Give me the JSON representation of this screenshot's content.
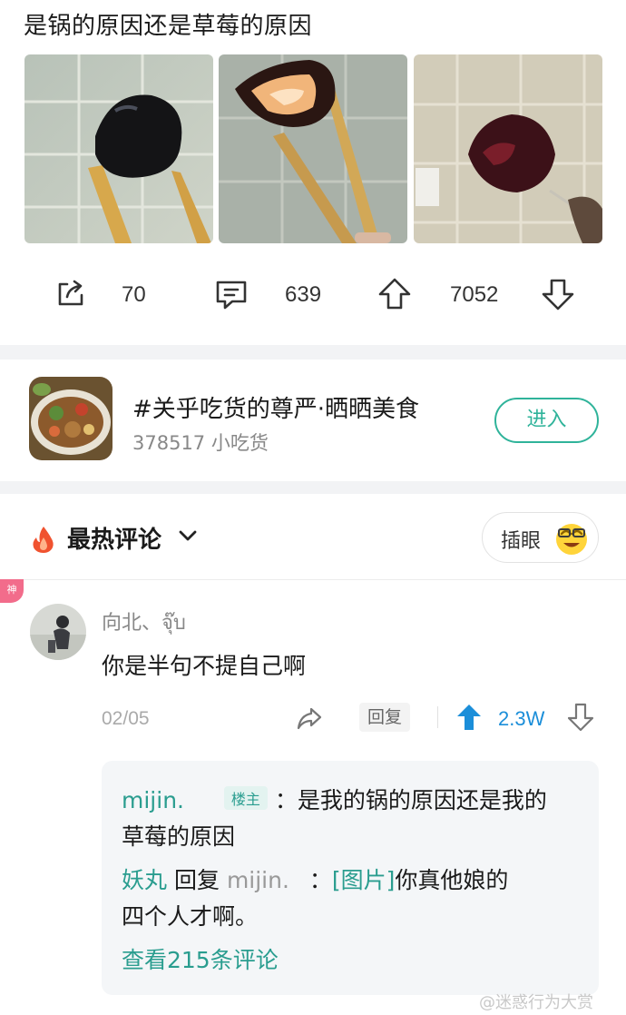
{
  "post": {
    "title": "是锅的原因还是草莓的原因"
  },
  "actions": {
    "share_count": "70",
    "comment_count": "639",
    "upvote_count": "7052"
  },
  "topic": {
    "name": "#关乎吃货的尊严·晒晒美食",
    "members": "378517 小吃货",
    "enter_label": "进入"
  },
  "comments_header": {
    "label": "最热评论",
    "insert_label": "插眼"
  },
  "badge": {
    "label": "神"
  },
  "comment": {
    "username": "向北、จุ๊บ",
    "text": "你是半句不提自己啊",
    "date": "02/05",
    "reply_label": "回复",
    "votes": "2.3W",
    "replies": [
      {
        "user": "mijin.",
        "tag": "楼主",
        "text_line1": "：是我的锅的原因还是我的",
        "text_line2": "草莓的原因"
      },
      {
        "user": "妖丸",
        "reply_word": "回复",
        "target": "mijin.",
        "colon": "：",
        "link": "[图片]",
        "text_line1": "你真他娘的",
        "text_line2": "四个人才啊。"
      }
    ],
    "view_more": "查看215条评论"
  },
  "watermark": "@迷惑行为大赏",
  "colors": {
    "teal": "#2fb39a",
    "blue": "#1b8ed9",
    "badge_pink": "#f26c8b"
  },
  "icons": [
    "share-icon",
    "comment-icon",
    "upvote-icon",
    "downvote-icon",
    "fire-icon",
    "chevron-down-icon",
    "grin-emoji-icon",
    "forward-icon",
    "upvote-filled-icon",
    "downvote-icon"
  ]
}
